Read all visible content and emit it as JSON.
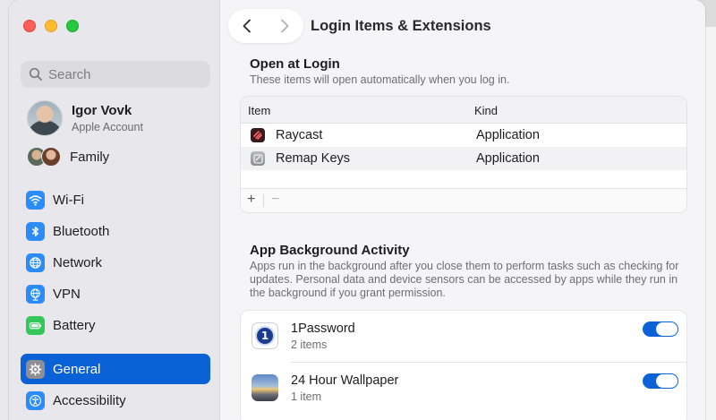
{
  "window": {
    "title": "Login Items & Extensions"
  },
  "sidebar": {
    "search_placeholder": "Search",
    "account": {
      "name": "Igor Vovk",
      "subtitle": "Apple Account"
    },
    "family_label": "Family",
    "items": [
      {
        "label": "Wi-Fi",
        "icon": "wifi-icon",
        "active": false
      },
      {
        "label": "Bluetooth",
        "icon": "bluetooth-icon",
        "active": false
      },
      {
        "label": "Network",
        "icon": "globe-icon",
        "active": false
      },
      {
        "label": "VPN",
        "icon": "vpn-globe-icon",
        "active": false
      },
      {
        "label": "Battery",
        "icon": "battery-icon",
        "active": false
      },
      {
        "label": "General",
        "icon": "gear-icon",
        "active": true
      },
      {
        "label": "Accessibility",
        "icon": "accessibility-icon",
        "active": false
      }
    ]
  },
  "open_at_login": {
    "title": "Open at Login",
    "description": "These items will open automatically when you log in.",
    "columns": [
      "Item",
      "Kind"
    ],
    "rows": [
      {
        "name": "Raycast",
        "kind": "Application",
        "icon": "raycast-icon"
      },
      {
        "name": "Remap Keys",
        "kind": "Application",
        "icon": "remap-keys-icon"
      }
    ],
    "add_label": "+",
    "remove_label": "−"
  },
  "background_activity": {
    "title": "App Background Activity",
    "description": "Apps run in the background after you close them to perform tasks such as checking for updates. Personal data and device sensors can be accessed by apps while they run in the background if you grant permission.",
    "items": [
      {
        "name": "1Password",
        "subtitle": "2 items",
        "enabled": true,
        "icon": "1password-icon"
      },
      {
        "name": "24 Hour Wallpaper",
        "subtitle": "1 item",
        "enabled": true,
        "icon": "24-hour-wallpaper-icon"
      }
    ]
  },
  "colors": {
    "accent": "#0a62d6",
    "sidebar_bg": "#e8e7ec",
    "window_bg": "#f5f5f7"
  }
}
